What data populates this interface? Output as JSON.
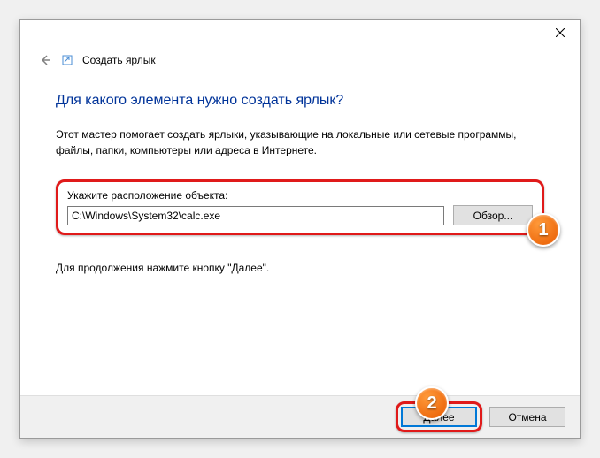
{
  "window": {
    "breadcrumb": "Создать ярлык",
    "close_label": "Закрыть"
  },
  "main": {
    "heading": "Для какого элемента нужно создать ярлык?",
    "description": "Этот мастер помогает создать ярлыки, указывающие на локальные или сетевые программы, файлы, папки, компьютеры или адреса в Интернете.",
    "input_label": "Укажите расположение объекта:",
    "path_value": "C:\\Windows\\System32\\calc.exe",
    "browse_label": "Обзор...",
    "continue_hint": "Для продолжения нажмите кнопку \"Далее\"."
  },
  "footer": {
    "next_label": "Далее",
    "cancel_label": "Отмена"
  },
  "annotations": {
    "badge1": "1",
    "badge2": "2"
  }
}
